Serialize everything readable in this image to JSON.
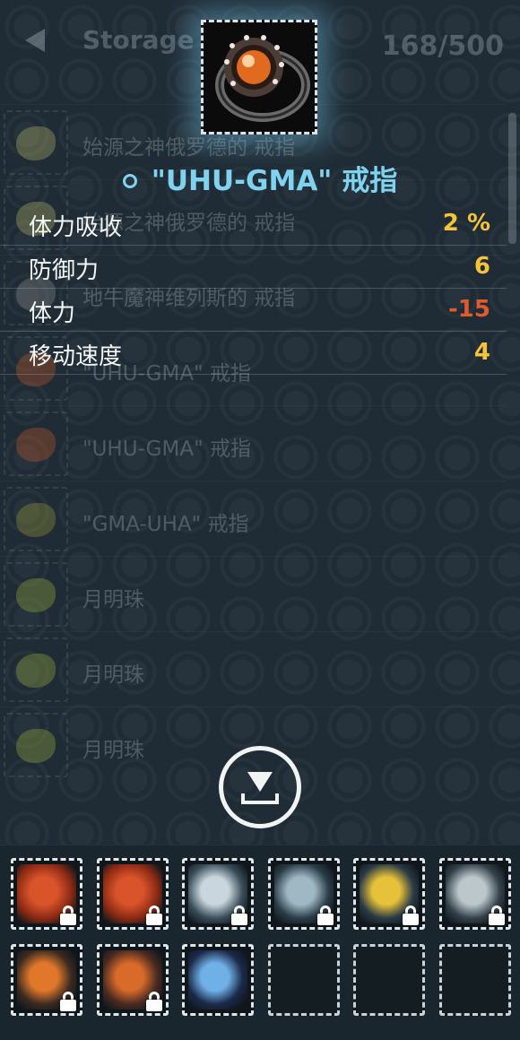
{
  "header": {
    "title": "Storage",
    "capacity": "168/500"
  },
  "list": [
    {
      "name": "始源之神俄罗德的 戒指",
      "color": "#b8b46a"
    },
    {
      "name": "始源之神俄罗德的 戒指",
      "color": "#b8b46a"
    },
    {
      "name": "地牛魔神维列斯的 戒指",
      "color": "#8a8a8a"
    },
    {
      "name": "\"UHU-GMA\" 戒指",
      "color": "#c0592a"
    },
    {
      "name": "\"UHU-GMA\" 戒指",
      "color": "#c0592a"
    },
    {
      "name": "\"GMA-UHA\" 戒指",
      "color": "#9a9a3a"
    },
    {
      "name": "月明珠",
      "color": "#9ab040"
    },
    {
      "name": "月明珠",
      "color": "#9ab040"
    },
    {
      "name": "月明珠",
      "color": "#9ab040"
    }
  ],
  "detail": {
    "icon": "ring-icon",
    "title": "\"UHU-GMA\" 戒指",
    "stats": [
      {
        "label": "体力吸收",
        "value": "2 %",
        "color": "#f5c33b"
      },
      {
        "label": "防御力",
        "value": "6",
        "color": "#f5c33b"
      },
      {
        "label": "体力",
        "value": "-15",
        "color": "#e0592f"
      },
      {
        "label": "移动速度",
        "value": "4",
        "color": "#f5c33b"
      }
    ]
  },
  "inventory": {
    "slots": [
      {
        "art": "red-spiked-ring",
        "locked": true,
        "colors": [
          "#d9532b",
          "#8b2a14"
        ]
      },
      {
        "art": "red-spiked-ring",
        "locked": true,
        "colors": [
          "#d9532b",
          "#8b2a14"
        ]
      },
      {
        "art": "spiked-silver-amulet",
        "locked": true,
        "colors": [
          "#c9d6de",
          "#3a4e5a"
        ]
      },
      {
        "art": "silver-gauntlet",
        "locked": true,
        "colors": [
          "#9fb8c4",
          "#2a3d48"
        ]
      },
      {
        "art": "gold-claw",
        "locked": true,
        "colors": [
          "#e6c13a",
          "#2a3a44"
        ]
      },
      {
        "art": "silver-claw",
        "locked": true,
        "colors": [
          "#bcc7cc",
          "#33414a"
        ]
      },
      {
        "art": "orange-gem-ring",
        "locked": true,
        "colors": [
          "#e0772b",
          "#3a2a20"
        ]
      },
      {
        "art": "flame-gauntlet",
        "locked": true,
        "colors": [
          "#d86a2a",
          "#4a2a20"
        ]
      },
      {
        "art": "rainbow-orb-ring",
        "locked": false,
        "colors": [
          "#6fb0e6",
          "#1b2a4a"
        ]
      },
      {
        "art": "empty",
        "locked": false,
        "colors": []
      },
      {
        "art": "empty",
        "locked": false,
        "colors": []
      },
      {
        "art": "empty",
        "locked": false,
        "colors": []
      }
    ]
  }
}
